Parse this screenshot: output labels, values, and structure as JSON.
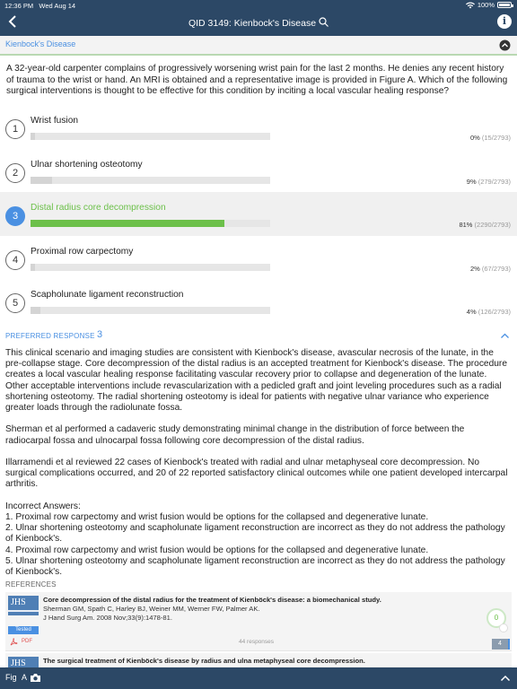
{
  "status_bar": {
    "time": "12:36 PM",
    "date": "Wed Aug 14",
    "battery": "100%"
  },
  "nav": {
    "title": "QID 3149: Kienbock's Disease",
    "avatar_letter": "i"
  },
  "breadcrumb": "Kienbock's Disease",
  "question": "A 32-year-old carpenter complains of progressively worsening wrist pain for the last 2 months.  He denies any recent history of trauma to the wrist or hand. An MRI is obtained and a representative image is provided in Figure A.  Which of the following surgical interventions is thought to be effective for this condition by inciting a local vascular healing response?",
  "options": [
    {
      "number": "1",
      "text": "Wrist fusion",
      "percent_label": "0%",
      "count_label": "(15/2793)",
      "fraction": 0.0,
      "correct": false
    },
    {
      "number": "2",
      "text": "Ulnar shortening osteotomy",
      "percent_label": "9%",
      "count_label": "(279/2793)",
      "fraction": 0.09,
      "correct": false
    },
    {
      "number": "3",
      "text": "Distal radius core decompression",
      "percent_label": "81%",
      "count_label": "(2290/2793)",
      "fraction": 0.81,
      "correct": true
    },
    {
      "number": "4",
      "text": "Proximal row carpectomy",
      "percent_label": "2%",
      "count_label": "(67/2793)",
      "fraction": 0.02,
      "correct": false
    },
    {
      "number": "5",
      "text": "Scapholunate ligament reconstruction",
      "percent_label": "4%",
      "count_label": "(126/2793)",
      "fraction": 0.04,
      "correct": false
    }
  ],
  "preferred_response": {
    "label": "PREFERRED RESPONSE",
    "value": "3"
  },
  "explanation": {
    "p1": "This clinical scenario and imaging studies are consistent with Kienbock's disease, avascular necrosis of the lunate, in the pre-collapse stage.  Core decompression of the distal radius is an accepted treatment for Kienbock's disease.  The procedure creates a local vascular healing response facilitating vascular recovery prior to collapse and degeneration of the lunate.  Other acceptable interventions include revascularization with a pedicled graft and joint leveling procedures such as a radial shortening osteotomy.  The radial shortening osteotomy is ideal for patients with negative ulnar variance who experience greater loads through the radiolunate fossa.",
    "p2": "Sherman et al performed a cadaveric study demonstrating minimal change in the distribution of force between the radiocarpal fossa and ulnocarpal fossa following core decompression of the distal radius.",
    "p3": "Illarramendi et al reviewed 22 cases of Kienbock's treated with radial and ulnar metaphyseal core decompression.  No surgical complications occurred, and 20 of 22 reported satisfactory clinical outcomes while one patient developed intercarpal arthritis.",
    "incorrect_heading": "Incorrect Answers:",
    "incorrect": [
      "1.  Proximal row carpectomy and wrist fusion would be options for the collapsed and degenerative lunate.",
      "2.  Ulnar shortening osteotomy and scapholunate ligament reconstruction are incorrect as they do not address the pathology of Kienbock's.",
      "4.  Proximal row carpectomy and wrist fusion would be options for the collapsed and degenerative lunate.",
      "5.  Ulnar shortening osteotomy and scapholunate ligament reconstruction are incorrect as they do not address the pathology of Kienbock's."
    ]
  },
  "references": {
    "label": "REFERENCES",
    "items": [
      {
        "journal_logo": "JHS",
        "title": "Core decompression of the distal radius for the treatment of Kienböck's disease: a biomechanical study.",
        "authors": "Sherman GM, Spath C, Harley BJ, Weiner MM, Werner FW, Palmer AK.",
        "citation": "J Hand Surg Am. 2008 Nov;33(9):1478-81.",
        "tested_label": "Tested",
        "pdf_label": "PDF",
        "responses": "44 responses",
        "score": "0",
        "comments": "4"
      },
      {
        "journal_logo": "JHS",
        "title": "The surgical treatment of Kienböck's disease by radius and ulna metaphyseal core decompression."
      }
    ]
  },
  "bottom_bar": {
    "fig_label": "Fig",
    "font_label": "A"
  },
  "colors": {
    "nav": "#2c4866",
    "accent": "#4a90e2",
    "correct": "#6cc04a"
  }
}
